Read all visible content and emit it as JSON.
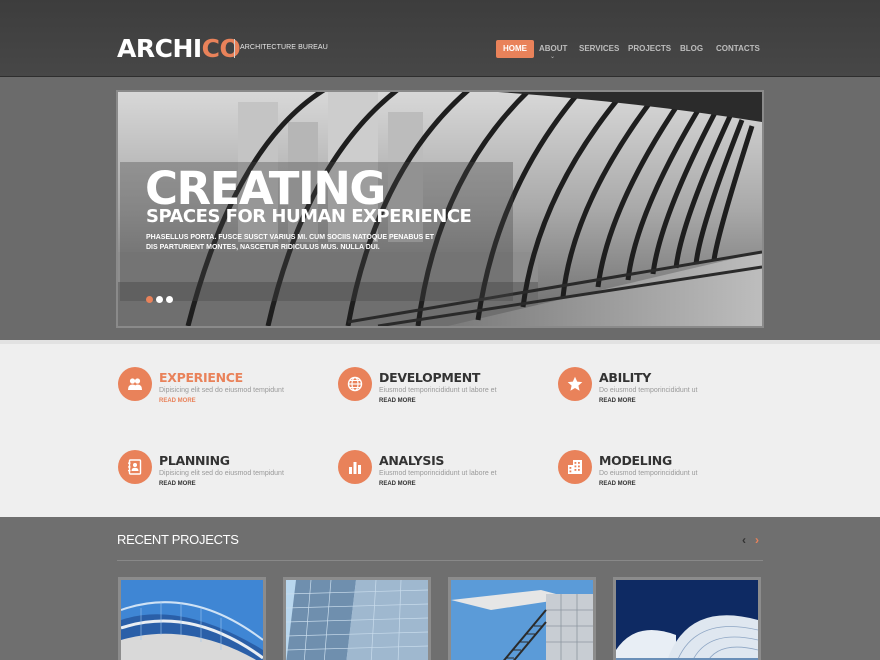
{
  "header": {
    "logo_main": "ARCHI",
    "logo_accent": "CO",
    "tagline": "ARCHITECTURE BUREAU",
    "nav": [
      {
        "label": "HOME",
        "active": true
      },
      {
        "label": "ABOUT",
        "active": false
      },
      {
        "label": "SERVICES",
        "active": false
      },
      {
        "label": "PROJECTS",
        "active": false
      },
      {
        "label": "BLOG",
        "active": false
      },
      {
        "label": "CONTACTS",
        "active": false
      }
    ],
    "nav_caret": "⌄"
  },
  "slider": {
    "title": "CREATING",
    "subtitle": "SPACES FOR HUMAN EXPERIENCE",
    "text": "PHASELLUS PORTA. FUSCE SUSCT VARIUS MI. CUM SOCIIS NATOQUE PENABUS ET DIS PARTURIENT MONTES, NASCETUR RIDICULUS MUS. NULLA DUI.",
    "slide_count": 3,
    "active_slide": 1
  },
  "services": [
    {
      "title": "EXPERIENCE",
      "desc": "Dipisicing elit sed do eiusmod tempidunt",
      "more": "READ MORE",
      "icon": "users-icon",
      "highlight": true
    },
    {
      "title": "DEVELOPMENT",
      "desc": "Eiusmod temporincididunt ut labore et",
      "more": "READ MORE",
      "icon": "globe-icon",
      "highlight": false
    },
    {
      "title": "ABILITY",
      "desc": "Do eiusmod temporincididunt ut",
      "more": "READ MORE",
      "icon": "star-icon",
      "highlight": false
    },
    {
      "title": "PLANNING",
      "desc": "Dipisicing elit sed do eiusmod tempidunt",
      "more": "READ MORE",
      "icon": "contact-book-icon",
      "highlight": false
    },
    {
      "title": "ANALYSIS",
      "desc": "Eiusmod temporincididunt ut labore et",
      "more": "READ MORE",
      "icon": "bar-chart-icon",
      "highlight": false
    },
    {
      "title": "MODELING",
      "desc": "Do eiusmod temporincididunt ut",
      "more": "READ MORE",
      "icon": "building-icon",
      "highlight": false
    }
  ],
  "recent": {
    "title": "RECENT PROJECTS",
    "prev": "‹",
    "next": "›",
    "projects": [
      "curved-glass-building-image",
      "glass-skyscraper-image",
      "modern-facade-stairs-image",
      "white-futuristic-building-image"
    ]
  },
  "colors": {
    "accent": "#e9825a",
    "header_bg": "#424242",
    "page_bg": "#6e6e6e",
    "services_bg": "#efefef"
  }
}
